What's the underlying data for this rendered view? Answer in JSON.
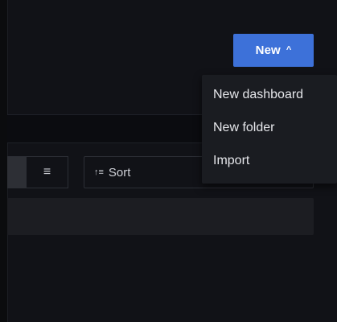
{
  "header": {
    "new_button": {
      "label": "New",
      "caret": "^",
      "color": "#3d71d9"
    }
  },
  "toolbar": {
    "view_toggle": {
      "list_icon": "≡",
      "list_icon_name": "list-view-icon"
    },
    "sort": {
      "icon": "↑≡",
      "icon_name": "sort-icon",
      "label": "Sort"
    }
  },
  "new_menu": {
    "items": [
      {
        "label": "New dashboard"
      },
      {
        "label": "New folder"
      },
      {
        "label": "Import"
      }
    ]
  },
  "colors": {
    "background": "#111217",
    "menu_background": "#1a1c21",
    "panel": "#1c1d22",
    "border": "#2c2f36",
    "text": "#e6e7eb"
  }
}
